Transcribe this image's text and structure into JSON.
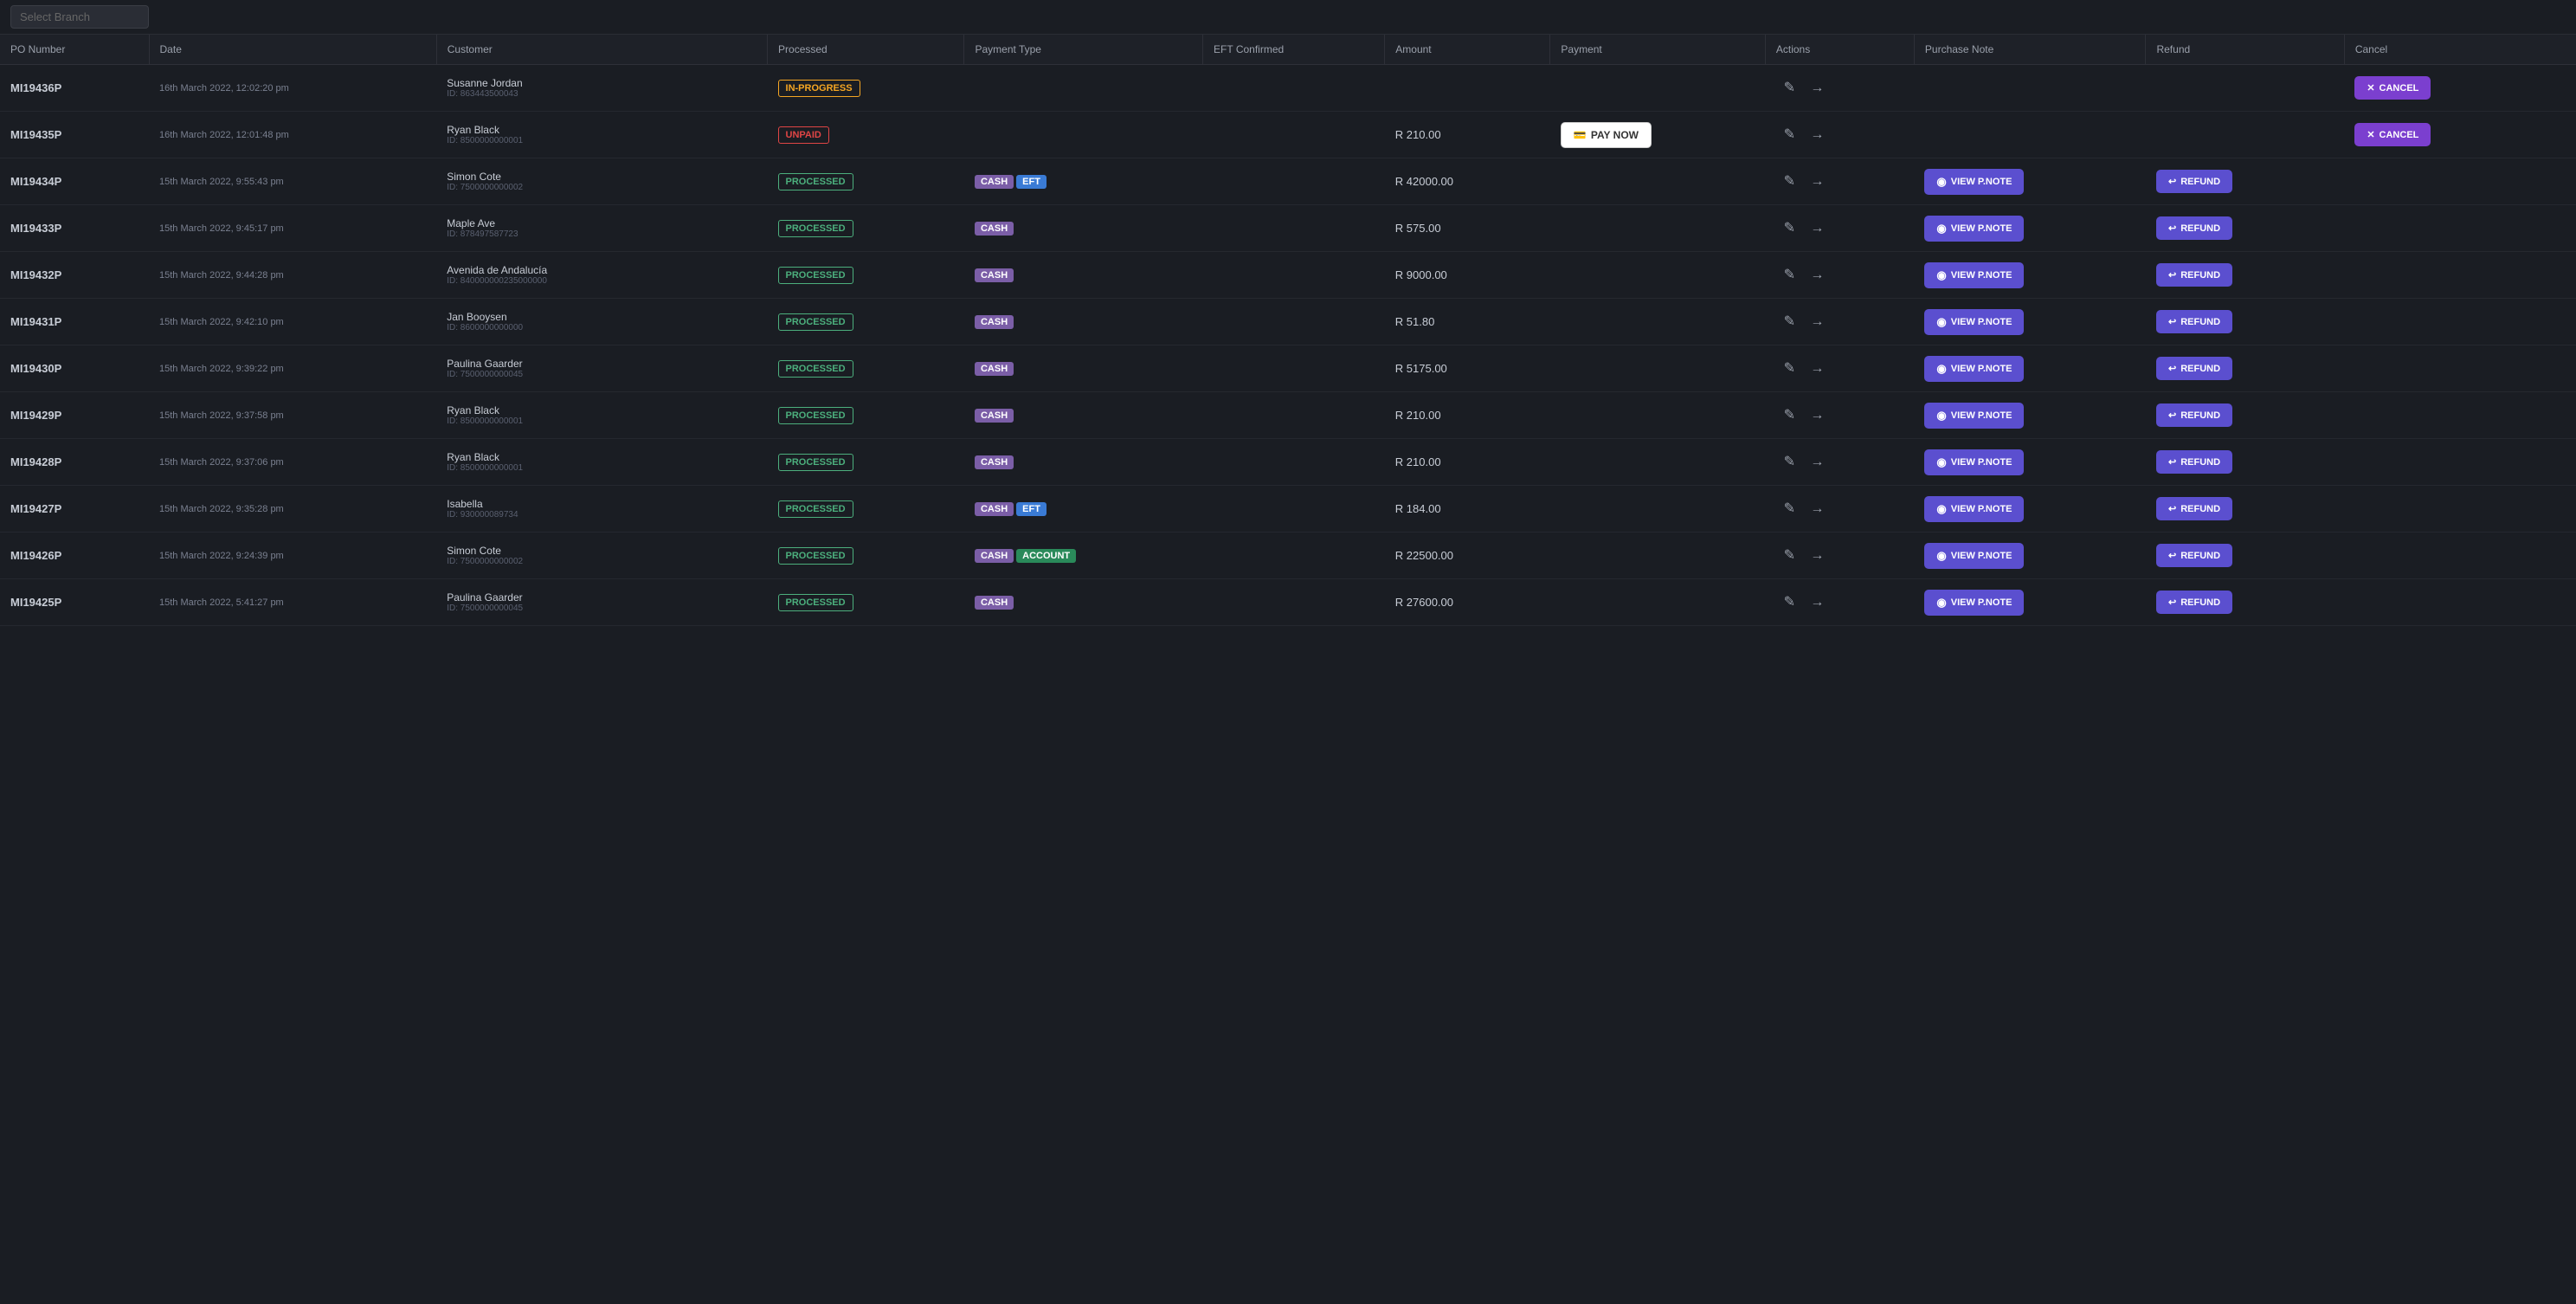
{
  "topbar": {
    "search_placeholder": "Select Branch"
  },
  "columns": {
    "po_number": "PO Number",
    "date": "Date",
    "customer": "Customer",
    "processed": "Processed",
    "payment_type": "Payment Type",
    "eft_confirmed": "EFT Confirmed",
    "amount": "Amount",
    "payment": "Payment",
    "actions": "Actions",
    "purchase_note": "Purchase Note",
    "refund": "Refund",
    "cancel": "Cancel"
  },
  "rows": [
    {
      "po": "MI19436P",
      "date": "16th March 2022, 12:02:20 pm",
      "customer_name": "Susanne Jordan",
      "customer_id": "ID: 863443500043",
      "status": "IN-PROGRESS",
      "status_type": "inprogress",
      "payment_badges": [],
      "eft_confirmed": "",
      "amount": "",
      "show_paynow": false,
      "show_cancel": true,
      "show_refund": false,
      "show_pnote": false
    },
    {
      "po": "MI19435P",
      "date": "16th March 2022, 12:01:48 pm",
      "customer_name": "Ryan Black",
      "customer_id": "ID: 8500000000001",
      "status": "UNPAID",
      "status_type": "unpaid",
      "payment_badges": [],
      "eft_confirmed": "",
      "amount": "R 210.00",
      "show_paynow": true,
      "show_cancel": true,
      "show_refund": false,
      "show_pnote": false
    },
    {
      "po": "MI19434P",
      "date": "15th March 2022, 9:55:43 pm",
      "customer_name": "Simon Cote",
      "customer_id": "ID: 7500000000002",
      "status": "PROCESSED",
      "status_type": "processed",
      "payment_badges": [
        "CASH",
        "EFT"
      ],
      "eft_confirmed": "",
      "amount": "R 42000.00",
      "show_paynow": false,
      "show_cancel": false,
      "show_refund": true,
      "show_pnote": true
    },
    {
      "po": "MI19433P",
      "date": "15th March 2022, 9:45:17 pm",
      "customer_name": "Maple Ave",
      "customer_id": "ID: 878497587723",
      "status": "PROCESSED",
      "status_type": "processed",
      "payment_badges": [
        "CASH"
      ],
      "eft_confirmed": "",
      "amount": "R 575.00",
      "show_paynow": false,
      "show_cancel": false,
      "show_refund": true,
      "show_pnote": true
    },
    {
      "po": "MI19432P",
      "date": "15th March 2022, 9:44:28 pm",
      "customer_name": "Avenida de Andalucía",
      "customer_id": "ID: 840000000235000000",
      "status": "PROCESSED",
      "status_type": "processed",
      "payment_badges": [
        "CASH"
      ],
      "eft_confirmed": "",
      "amount": "R 9000.00",
      "show_paynow": false,
      "show_cancel": false,
      "show_refund": true,
      "show_pnote": true
    },
    {
      "po": "MI19431P",
      "date": "15th March 2022, 9:42:10 pm",
      "customer_name": "Jan Booysen",
      "customer_id": "ID: 8600000000000",
      "status": "PROCESSED",
      "status_type": "processed",
      "payment_badges": [
        "CASH"
      ],
      "eft_confirmed": "",
      "amount": "R 51.80",
      "show_paynow": false,
      "show_cancel": false,
      "show_refund": true,
      "show_pnote": true
    },
    {
      "po": "MI19430P",
      "date": "15th March 2022, 9:39:22 pm",
      "customer_name": "Paulina Gaarder",
      "customer_id": "ID: 7500000000045",
      "status": "PROCESSED",
      "status_type": "processed",
      "payment_badges": [
        "CASH"
      ],
      "eft_confirmed": "",
      "amount": "R 5175.00",
      "show_paynow": false,
      "show_cancel": false,
      "show_refund": true,
      "show_pnote": true
    },
    {
      "po": "MI19429P",
      "date": "15th March 2022, 9:37:58 pm",
      "customer_name": "Ryan Black",
      "customer_id": "ID: 8500000000001",
      "status": "PROCESSED",
      "status_type": "processed",
      "payment_badges": [
        "CASH"
      ],
      "eft_confirmed": "",
      "amount": "R 210.00",
      "show_paynow": false,
      "show_cancel": false,
      "show_refund": true,
      "show_pnote": true
    },
    {
      "po": "MI19428P",
      "date": "15th March 2022, 9:37:06 pm",
      "customer_name": "Ryan Black",
      "customer_id": "ID: 8500000000001",
      "status": "PROCESSED",
      "status_type": "processed",
      "payment_badges": [
        "CASH"
      ],
      "eft_confirmed": "",
      "amount": "R 210.00",
      "show_paynow": false,
      "show_cancel": false,
      "show_refund": true,
      "show_pnote": true
    },
    {
      "po": "MI19427P",
      "date": "15th March 2022, 9:35:28 pm",
      "customer_name": "Isabella",
      "customer_id": "ID: 930000089734",
      "status": "PROCESSED",
      "status_type": "processed",
      "payment_badges": [
        "CASH",
        "EFT"
      ],
      "eft_confirmed": "",
      "amount": "R 184.00",
      "show_paynow": false,
      "show_cancel": false,
      "show_refund": true,
      "show_pnote": true
    },
    {
      "po": "MI19426P",
      "date": "15th March 2022, 9:24:39 pm",
      "customer_name": "Simon Cote",
      "customer_id": "ID: 7500000000002",
      "status": "PROCESSED",
      "status_type": "processed",
      "payment_badges": [
        "CASH",
        "ACCOUNT"
      ],
      "eft_confirmed": "",
      "amount": "R 22500.00",
      "show_paynow": false,
      "show_cancel": false,
      "show_refund": true,
      "show_pnote": true
    },
    {
      "po": "MI19425P",
      "date": "15th March 2022, 5:41:27 pm",
      "customer_name": "Paulina Gaarder",
      "customer_id": "ID: 7500000000045",
      "status": "PROCESSED",
      "status_type": "processed",
      "payment_badges": [
        "CASH"
      ],
      "eft_confirmed": "",
      "amount": "R 27600.00",
      "show_paynow": false,
      "show_cancel": false,
      "show_refund": true,
      "show_pnote": true
    }
  ],
  "buttons": {
    "view_pnote": "VIEW P.NOTE",
    "refund": "REFUND",
    "cancel": "CANCEL",
    "pay_now": "PAY NOW"
  },
  "icons": {
    "edit": "✎",
    "arrow_right": "→",
    "eye": "◉",
    "refund_icon": "⟲",
    "cancel_icon": "✕",
    "credit_card": "💳"
  }
}
